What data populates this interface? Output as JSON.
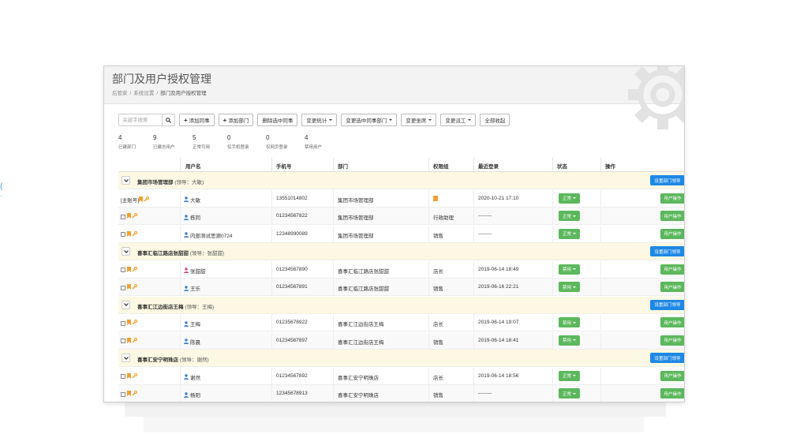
{
  "page": {
    "title": "部门及用户授权管理",
    "breadcrumb": [
      "后管家",
      "系统设置",
      "部门及用户授权管理"
    ],
    "breadcrumb_sep": "/"
  },
  "toolbar": {
    "search_placeholder": "关键字搜索",
    "buttons": [
      {
        "label": "添加同事",
        "prefix": "+"
      },
      {
        "label": "添加部门",
        "prefix": "+"
      },
      {
        "label": "删除选中同事"
      },
      {
        "label": "变更统计",
        "dropdown": true
      },
      {
        "label": "变更选中同事部门",
        "dropdown": true
      },
      {
        "label": "变更坐席",
        "dropdown": true
      },
      {
        "label": "变更派工",
        "dropdown": true
      },
      {
        "label": "全部收起"
      }
    ]
  },
  "stats": [
    {
      "value": "4",
      "label": "已建部门"
    },
    {
      "value": "9",
      "label": "已建总用户"
    },
    {
      "value": "5",
      "label": "正常可用"
    },
    {
      "value": "0",
      "label": "仅手机登录"
    },
    {
      "value": "0",
      "label": "仅网页登录"
    },
    {
      "value": "4",
      "label": "禁用用户"
    }
  ],
  "table": {
    "columns": [
      "用户名",
      "手机号",
      "部门",
      "权限组",
      "最近登录",
      "状态",
      "操作"
    ],
    "set_leader_label": "设置部门领导",
    "user_op_label": "用户操作",
    "groups": [
      {
        "name": "集团市场管理部",
        "leader": "(领导：大敏)",
        "users": [
          {
            "prefix": "[主账号]",
            "checkbox": false,
            "name": "大敏",
            "gender": "male",
            "phone": "13551014802",
            "dept": "集团市场管理部",
            "role": "",
            "role_icon": true,
            "last_login": "2020-10-21 17:10",
            "status": "正常"
          },
          {
            "prefix": "",
            "checkbox": true,
            "name": "栋同",
            "gender": "male",
            "phone": "01234567822",
            "dept": "集团市场管理部",
            "role": "行政助理",
            "role_icon": false,
            "last_login": "--------",
            "status": "正常"
          },
          {
            "prefix": "",
            "checkbox": true,
            "name": "内部测试思源0724",
            "gender": "male",
            "phone": "12348990089",
            "dept": "集团市场管理部",
            "role": "销售",
            "role_icon": false,
            "last_login": "--------",
            "status": "正常"
          }
        ]
      },
      {
        "name": "喜事汇临江路店张甜甜",
        "leader": "(领导：张甜甜)",
        "users": [
          {
            "prefix": "",
            "checkbox": true,
            "name": "张甜甜",
            "gender": "female",
            "phone": "01234567890",
            "dept": "喜事汇临江路店张甜甜",
            "role": "店长",
            "role_icon": false,
            "last_login": "2019-06-14 18:49",
            "status": "禁用"
          },
          {
            "prefix": "",
            "checkbox": true,
            "name": "王乐",
            "gender": "male",
            "phone": "01234567891",
            "dept": "喜事汇临江路店张甜甜",
            "role": "销售",
            "role_icon": false,
            "last_login": "2019-06-16 22:21",
            "status": "禁用"
          }
        ]
      },
      {
        "name": "喜事汇江边街店王梅",
        "leader": "(领导：王梅)",
        "users": [
          {
            "prefix": "",
            "checkbox": true,
            "name": "王梅",
            "gender": "male",
            "phone": "01235678922",
            "dept": "喜事汇江边街店王梅",
            "role": "店长",
            "role_icon": false,
            "last_login": "2019-06-14 19:07",
            "status": "禁用"
          },
          {
            "prefix": "",
            "checkbox": true,
            "name": "陈晨",
            "gender": "male",
            "phone": "01234567897",
            "dept": "喜事汇江边街店王梅",
            "role": "销售",
            "role_icon": false,
            "last_login": "2019-06-14 18:41",
            "status": "禁用"
          }
        ]
      },
      {
        "name": "喜事汇安宁明珠店",
        "leader": "(领导：谢然)",
        "users": [
          {
            "prefix": "",
            "checkbox": true,
            "name": "谢然",
            "gender": "male",
            "phone": "01234567892",
            "dept": "喜事汇安宁明珠店",
            "role": "店长",
            "role_icon": false,
            "last_login": "2019-06-14 18:56",
            "status": "正常"
          },
          {
            "prefix": "",
            "checkbox": true,
            "name": "杨阳",
            "gender": "male",
            "phone": "12345678913",
            "dept": "喜事汇安宁明珠店",
            "role": "销售",
            "role_icon": false,
            "last_login": "--------",
            "status": "正常"
          }
        ]
      }
    ]
  },
  "colors": {
    "primary_blue": "#1e88e5",
    "success_green": "#5cb85c",
    "group_bg": "#fcf8e3",
    "bookmark_orange": "#f0a030",
    "male_blue": "#3a7fc4",
    "female_pink": "#d9418a"
  }
}
